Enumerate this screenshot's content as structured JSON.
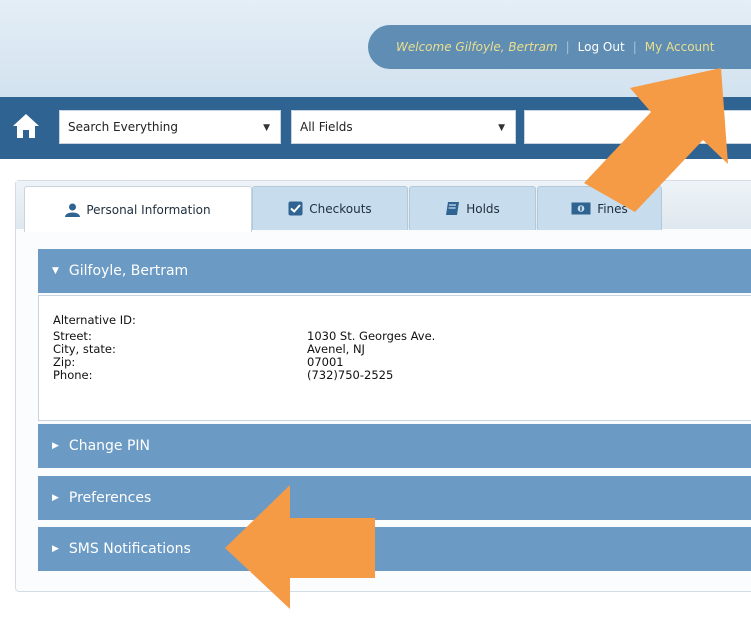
{
  "header": {
    "welcome": "Welcome Gilfoyle, Bertram",
    "logout": "Log Out",
    "separator": "|",
    "my_account": "My Account"
  },
  "search": {
    "scope_selected": "Search Everything",
    "field_selected": "All Fields",
    "query": ""
  },
  "tabs": [
    {
      "label": "Personal Information",
      "icon": "person-icon",
      "active": true
    },
    {
      "label": "Checkouts",
      "icon": "checkbox-icon",
      "active": false
    },
    {
      "label": "Holds",
      "icon": "book-icon",
      "active": false
    },
    {
      "label": "Fines",
      "icon": "money-icon",
      "active": false
    }
  ],
  "account": {
    "name": "Gilfoyle, Bertram",
    "fields": [
      {
        "label": "Alternative ID:",
        "value": ""
      },
      {
        "label": "Street:",
        "value": "1030 St. Georges Ave."
      },
      {
        "label": "City, state:",
        "value": "Avenel, NJ"
      },
      {
        "label": "Zip:",
        "value": "07001"
      },
      {
        "label": "Phone:",
        "value": "(732)750-2525"
      }
    ]
  },
  "sections": [
    "Change PIN",
    "Preferences",
    "SMS Notifications"
  ],
  "colors": {
    "nav_blue": "#2f6492",
    "accordion_blue": "#6b9ac4",
    "welcome_yellow": "#eadf8f",
    "arrow_orange": "#f59a45"
  }
}
